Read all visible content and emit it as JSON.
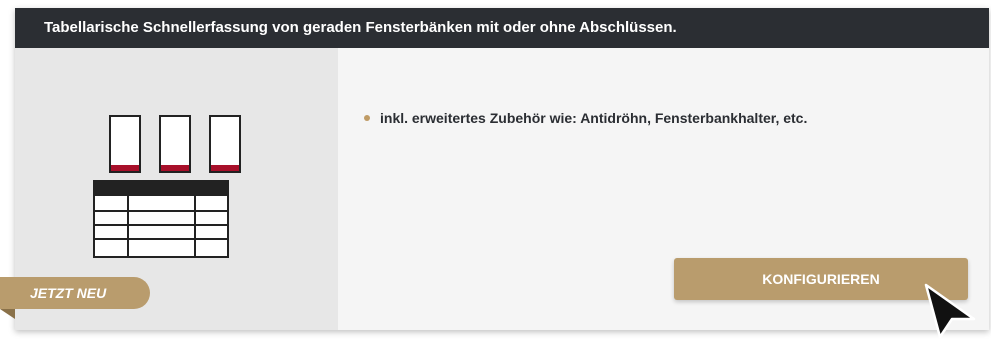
{
  "header": {
    "title": "Tabellarische Schnellerfassung von geraden Fensterbänken mit oder ohne Abschlüssen."
  },
  "features": {
    "items": [
      "inkl. erweitertes Zubehör wie: Antidröhn, Fensterbankhalter, etc."
    ]
  },
  "badge": {
    "label": "JETZT NEU"
  },
  "cta": {
    "label": "KONFIGURIEREN"
  },
  "colors": {
    "header_bg": "#2b2e33",
    "accent_gold": "#b99c6d",
    "sill_edge_red": "#a8102a"
  },
  "icons": {
    "illustration": "window-sills-table-icon",
    "cursor": "pointer-cursor-icon"
  }
}
